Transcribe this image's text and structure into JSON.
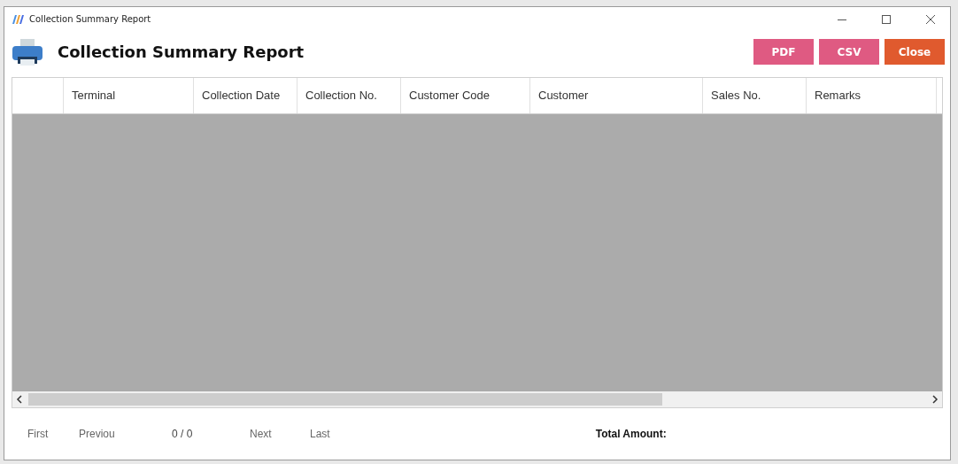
{
  "window": {
    "title": "Collection Summary Report"
  },
  "header": {
    "title": "Collection Summary Report"
  },
  "buttons": [
    {
      "label": "PDF",
      "kind": "export"
    },
    {
      "label": "CSV",
      "kind": "export"
    },
    {
      "label": "Close",
      "kind": "close"
    }
  ],
  "table": {
    "columns": [
      "Terminal",
      "Collection Date",
      "Collection No.",
      "Customer Code",
      "Customer",
      "Sales No.",
      "Remarks"
    ]
  },
  "pager": {
    "first": "First",
    "previous": "Previou",
    "position": "0 / 0",
    "next": "Next",
    "last": "Last"
  },
  "total": {
    "label": "Total Amount:"
  }
}
